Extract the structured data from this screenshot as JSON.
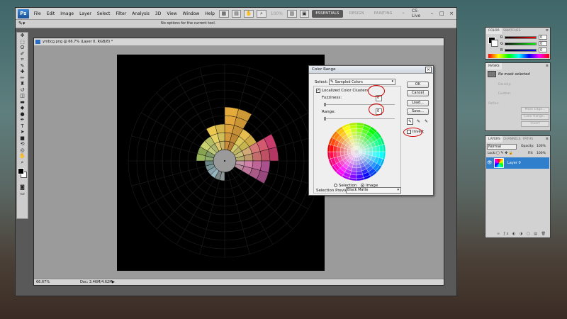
{
  "menu": {
    "logo": "Ps",
    "items": [
      "File",
      "Edit",
      "Image",
      "Layer",
      "Select",
      "Filter",
      "Analysis",
      "3D",
      "View",
      "Window",
      "Help"
    ],
    "zoom": "100%",
    "workspaces": [
      "ESSENTIALS",
      "DESIGN",
      "PAINTING"
    ],
    "more": "»",
    "cslive": "CS Live",
    "controls": [
      "–",
      "□",
      "×"
    ]
  },
  "options": {
    "status_text": "No options for the current tool."
  },
  "document": {
    "tab_title": "ymbcg.png @ 66.7% (Layer 0, RGB/8) *",
    "zoom": "66.67%",
    "doc_size": "Doc: 3.46M/4.62M"
  },
  "dialog": {
    "title": "Color Range",
    "close": "×",
    "select_label": "Select:",
    "select_value": "Sampled Colors",
    "localized_label": "Localized Color Clusters",
    "localized_checked": true,
    "fuzziness_label": "Fuzziness:",
    "fuzziness_value": "0",
    "range_label": "Range:",
    "range_value": "0",
    "buttons": {
      "ok": "OK",
      "cancel": "Cancel",
      "load": "Load...",
      "save": "Save..."
    },
    "invert_label": "Invert",
    "invert_checked": false,
    "radio_selection": "Selection",
    "radio_image": "Image",
    "preview_label": "Selection Preview:",
    "preview_value": "Black Matte"
  },
  "color_panel": {
    "tabs": [
      "COLOR",
      "SWATCHES"
    ],
    "r": "0",
    "g": "0",
    "b": "0"
  },
  "masks_panel": {
    "tab": "MASKS",
    "status": "No mask selected",
    "density": "Density:",
    "feather": "Feather:",
    "refine": "Refine:",
    "buttons": [
      "Mask Edge...",
      "Color Range...",
      "Invert"
    ]
  },
  "layers_panel": {
    "tabs": [
      "LAYERS",
      "CHANNELS",
      "PATHS"
    ],
    "blend_mode": "Normal",
    "opacity_label": "Opacity:",
    "opacity_value": "100%",
    "lock_label": "Lock:",
    "fill_label": "Fill:",
    "fill_value": "100%",
    "layer_name": "Layer 0"
  }
}
